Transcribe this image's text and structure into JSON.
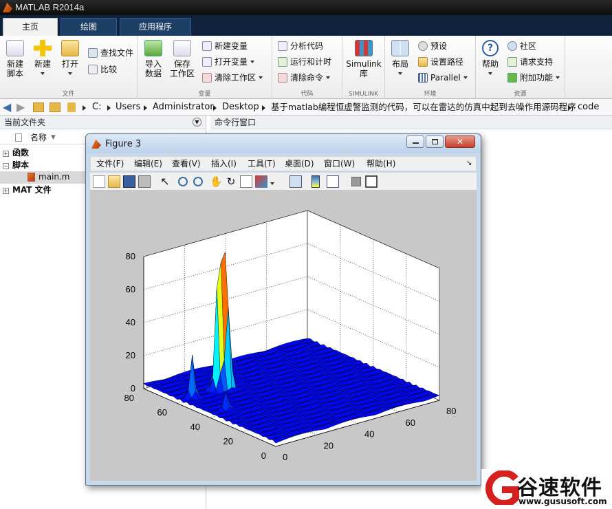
{
  "window": {
    "title": "MATLAB R2014a"
  },
  "tabs": [
    {
      "label": "主页"
    },
    {
      "label": "绘图"
    },
    {
      "label": "应用程序"
    }
  ],
  "ribbon": {
    "file": {
      "group": "文件",
      "new_script": [
        "新建",
        "脚本"
      ],
      "new": "新建",
      "open": "打开",
      "find_files": "查找文件",
      "compare": "比较"
    },
    "variable": {
      "group": "变量",
      "import": [
        "导入",
        "数据"
      ],
      "save": [
        "保存",
        "工作区"
      ],
      "new_var": "新建变量",
      "open_var": "打开变量",
      "clear_ws": "清除工作区"
    },
    "code": {
      "group": "代码",
      "analyze": "分析代码",
      "run_time": "运行和计时",
      "clear_cmd": "清除命令"
    },
    "simulink": {
      "group": "SIMULINK",
      "lib": [
        "Simulink",
        "库"
      ]
    },
    "env": {
      "group": "环境",
      "layout": "布局",
      "prefs": "预设",
      "set_path": "设置路径",
      "parallel": "Parallel"
    },
    "resources": {
      "group": "资源",
      "help": "帮助",
      "community": "社区",
      "support": "请求支持",
      "addons": "附加功能"
    }
  },
  "path": [
    "C:",
    "Users",
    "Administrator",
    "Desktop",
    "基于matlab编程恒虚警监测的代码，可以在雷达的仿真中起到去噪作用源码程序",
    "code"
  ],
  "current_folder": {
    "title": "当前文件夹",
    "col_name": "名称",
    "items": [
      {
        "label": "函数",
        "toggle": "+"
      },
      {
        "label": "脚本",
        "toggle": "−"
      },
      {
        "label": "main.m"
      },
      {
        "label": "MAT 文件",
        "toggle": "+"
      }
    ]
  },
  "command_window": {
    "title": "命令行窗口"
  },
  "figure": {
    "title": "Figure 3",
    "menus": [
      "文件(F)",
      "编辑(E)",
      "查看(V)",
      "插入(I)",
      "工具(T)",
      "桌面(D)",
      "窗口(W)",
      "帮助(H)"
    ],
    "z_ticks": [
      "0",
      "20",
      "40",
      "60",
      "80"
    ],
    "x_ticks": [
      "0",
      "20",
      "40",
      "60",
      "80"
    ],
    "y_ticks": [
      "0",
      "20",
      "40",
      "60",
      "80"
    ]
  },
  "chart_data": {
    "type": "surface",
    "title": "",
    "xlabel": "",
    "ylabel": "",
    "zlabel": "",
    "xlim": [
      0,
      80
    ],
    "ylim": [
      0,
      80
    ],
    "zlim": [
      0,
      80
    ],
    "grid": true,
    "colormap": "jet",
    "peaks": [
      {
        "x": 6,
        "y": 58,
        "z": 25
      },
      {
        "x": 8,
        "y": 40,
        "z": 10
      },
      {
        "x": 18,
        "y": 58,
        "z": 52
      },
      {
        "x": 20,
        "y": 58,
        "z": 60
      },
      {
        "x": 22,
        "y": 57,
        "z": 68
      },
      {
        "x": 23,
        "y": 58,
        "z": 45
      }
    ],
    "baseline": 2
  },
  "watermark": {
    "brand": "谷速软件",
    "url": "www.gususoft.com"
  }
}
